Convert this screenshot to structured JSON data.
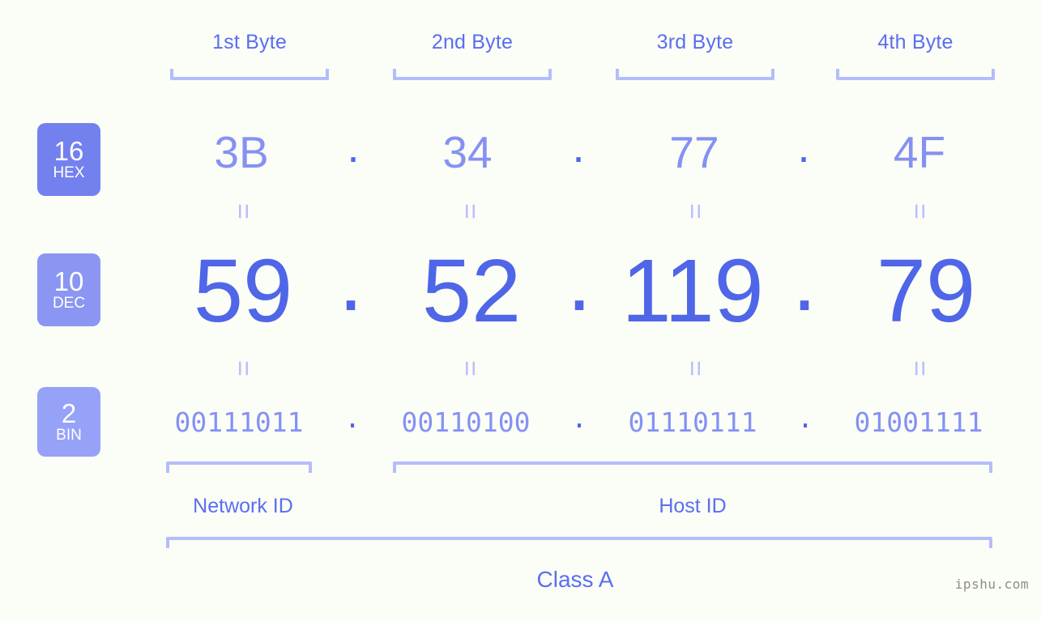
{
  "background_color": "#fbfdf7",
  "accent_colors": {
    "strong_blue": "#4f66e8",
    "mid_blue": "#5b6ef0",
    "soft_blue": "#8591f2",
    "pale_blue": "#b4bdfb",
    "badge_hex": "#7381ef",
    "badge_dec": "#8b96f3",
    "badge_bin": "#96a2f7",
    "watermark_gray": "#8d8d8d"
  },
  "byte_headers": [
    {
      "label": "1st Byte"
    },
    {
      "label": "2nd Byte"
    },
    {
      "label": "3rd Byte"
    },
    {
      "label": "4th Byte"
    }
  ],
  "bases": [
    {
      "number": "16",
      "abbr": "HEX"
    },
    {
      "number": "10",
      "abbr": "DEC"
    },
    {
      "number": "2",
      "abbr": "BIN"
    }
  ],
  "separator": ".",
  "equals_glyph": "=",
  "rows": {
    "hex": {
      "base_number": "16",
      "base_abbr": "HEX",
      "values": [
        "3B",
        "34",
        "77",
        "4F"
      ],
      "joined": "3B.34.77.4F"
    },
    "dec": {
      "base_number": "10",
      "base_abbr": "DEC",
      "values": [
        "59",
        "52",
        "119",
        "79"
      ],
      "joined": "59.52.119.79"
    },
    "bin": {
      "base_number": "2",
      "base_abbr": "BIN",
      "values": [
        "00111011",
        "00110100",
        "01110111",
        "01001111"
      ],
      "joined": "00111011.00110100.01110111.01001111"
    }
  },
  "segments": {
    "network_id_label": "Network ID",
    "host_id_label": "Host ID",
    "class_label": "Class A"
  },
  "watermark": "ipshu.com"
}
